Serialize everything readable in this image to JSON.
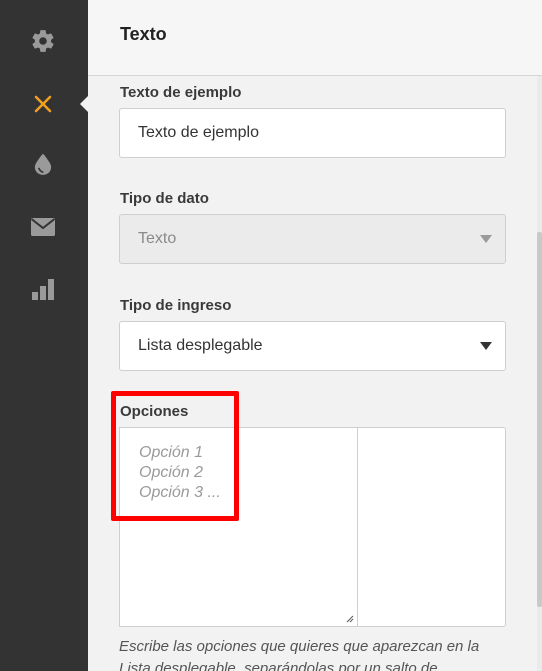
{
  "sidebar": {
    "items": [
      {
        "name": "settings",
        "icon": "gear-icon",
        "active": false
      },
      {
        "name": "close",
        "icon": "close-icon",
        "active": true
      },
      {
        "name": "color",
        "icon": "drop-icon",
        "active": false
      },
      {
        "name": "mail",
        "icon": "mail-icon",
        "active": false
      },
      {
        "name": "stats",
        "icon": "bar-chart-icon",
        "active": false
      }
    ],
    "accent_color": "#f0a020",
    "icon_color": "#9a9a9a"
  },
  "panel": {
    "title": "Texto",
    "example_text": {
      "label": "Texto de ejemplo",
      "value": "Texto de ejemplo"
    },
    "data_type": {
      "label": "Tipo de dato",
      "selected": "Texto",
      "disabled": true
    },
    "input_type": {
      "label": "Tipo de ingreso",
      "selected": "Lista desplegable"
    },
    "options": {
      "label": "Opciones",
      "placeholder_lines": [
        "Opción 1",
        "Opción 2",
        "Opción 3 ..."
      ]
    },
    "help_text": "Escribe las opciones que quieres que aparezcan en la Lista desplegable, separándolas por un salto de"
  },
  "highlight_color": "#ff0000"
}
